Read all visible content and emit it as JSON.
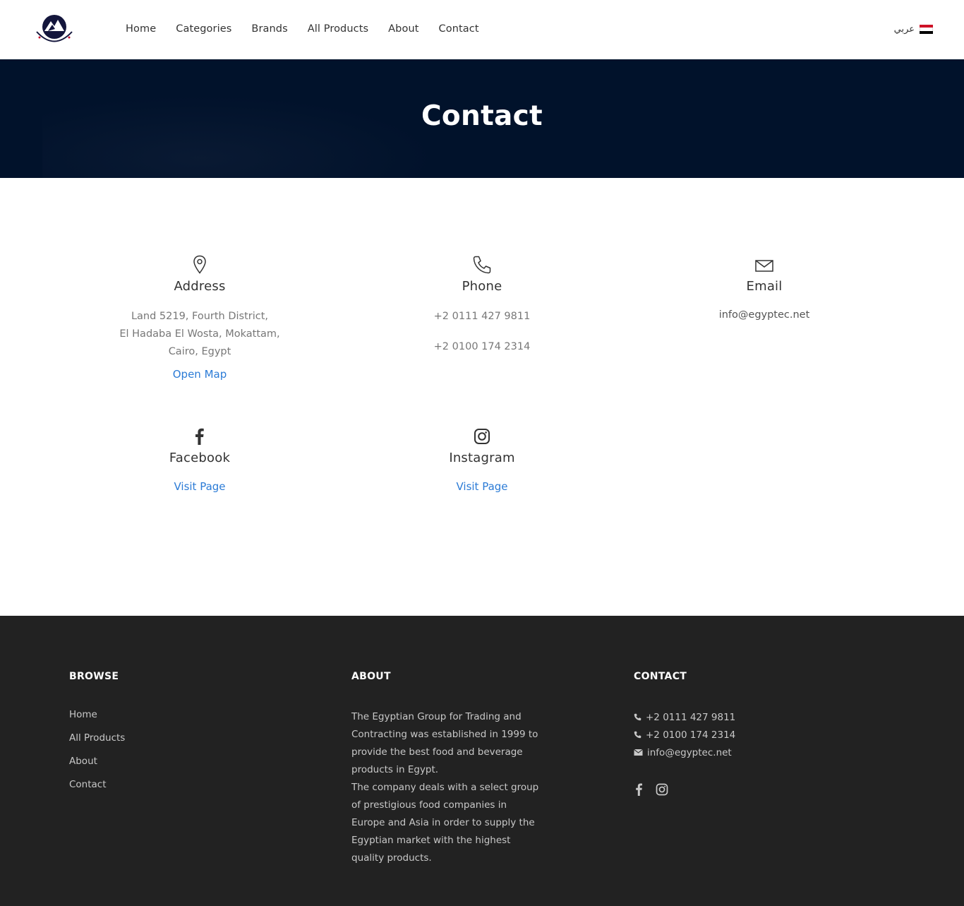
{
  "header": {
    "nav": [
      "Home",
      "Categories",
      "Brands",
      "All Products",
      "About",
      "Contact"
    ],
    "language_label": "عربي"
  },
  "hero": {
    "title": "Contact"
  },
  "contact": {
    "address": {
      "title": "Address",
      "lines": [
        "Land 5219, Fourth District,",
        "El Hadaba El Wosta, Mokattam,",
        "Cairo, Egypt"
      ],
      "link": "Open Map"
    },
    "phone": {
      "title": "Phone",
      "numbers": [
        "+2 0111 427 9811",
        "+2 0100 174 2314"
      ]
    },
    "email": {
      "title": "Email",
      "value": "info@egyptec.net"
    },
    "facebook": {
      "title": "Facebook",
      "link": "Visit Page"
    },
    "instagram": {
      "title": "Instagram",
      "link": "Visit Page"
    }
  },
  "footer": {
    "browse": {
      "heading": "BROWSE",
      "links": [
        "Home",
        "All Products",
        "About",
        "Contact"
      ]
    },
    "about": {
      "heading": "ABOUT",
      "text1": "The Egyptian Group for Trading and Contracting was established in 1999 to provide the best food and beverage products in Egypt.",
      "text2": "The company deals with a select group of prestigious food companies in Europe and Asia in order to supply the Egyptian market with the highest quality products."
    },
    "contact": {
      "heading": "CONTACT",
      "phone1": "+2 0111 427 9811",
      "phone2": "+2 0100 174 2314",
      "email": "info@egyptec.net"
    }
  },
  "colors": {
    "hero_bg": "#01122b",
    "footer_bg": "#222222",
    "link": "#2b7bd6",
    "flag_red": "#ce1126",
    "flag_black": "#000000"
  }
}
